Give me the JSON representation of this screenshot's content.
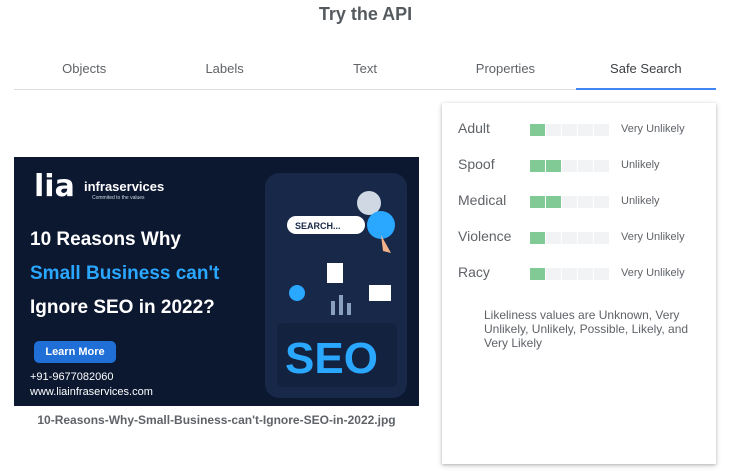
{
  "page": {
    "title": "Try the API"
  },
  "tabs": [
    {
      "label": "Objects",
      "active": false
    },
    {
      "label": "Labels",
      "active": false
    },
    {
      "label": "Text",
      "active": false
    },
    {
      "label": "Properties",
      "active": false
    },
    {
      "label": "Safe Search",
      "active": true
    }
  ],
  "image": {
    "filename": "10-Reasons-Why-Small-Business-can't-Ignore-SEO-in-2022.jpg",
    "logo": "lia",
    "logo_sub": "infraservices",
    "logo_tag": "Commited to the values",
    "headline_1": "10 Reasons Why",
    "headline_2": "Small Business can't",
    "headline_3": "Ignore SEO in 2022?",
    "button": "Learn More",
    "phone": "+91-9677082060",
    "website": "www.liainfraservices.com",
    "search_text": "SEARCH...",
    "seo_text": "SEO"
  },
  "safe_search": {
    "segments": 5,
    "rows": [
      {
        "label": "Adult",
        "level": 1,
        "value": "Very Unlikely"
      },
      {
        "label": "Spoof",
        "level": 2,
        "value": "Unlikely"
      },
      {
        "label": "Medical",
        "level": 2,
        "value": "Unlikely"
      },
      {
        "label": "Violence",
        "level": 1,
        "value": "Very Unlikely"
      },
      {
        "label": "Racy",
        "level": 1,
        "value": "Very Unlikely"
      }
    ],
    "note": "Likeliness values are Unknown, Very Unlikely, Unlikely, Possible, Likely, and Very Likely"
  },
  "colors": {
    "accent": "#4285f4",
    "bar_on": "#81c995",
    "bar_off": "#f1f3f4"
  }
}
